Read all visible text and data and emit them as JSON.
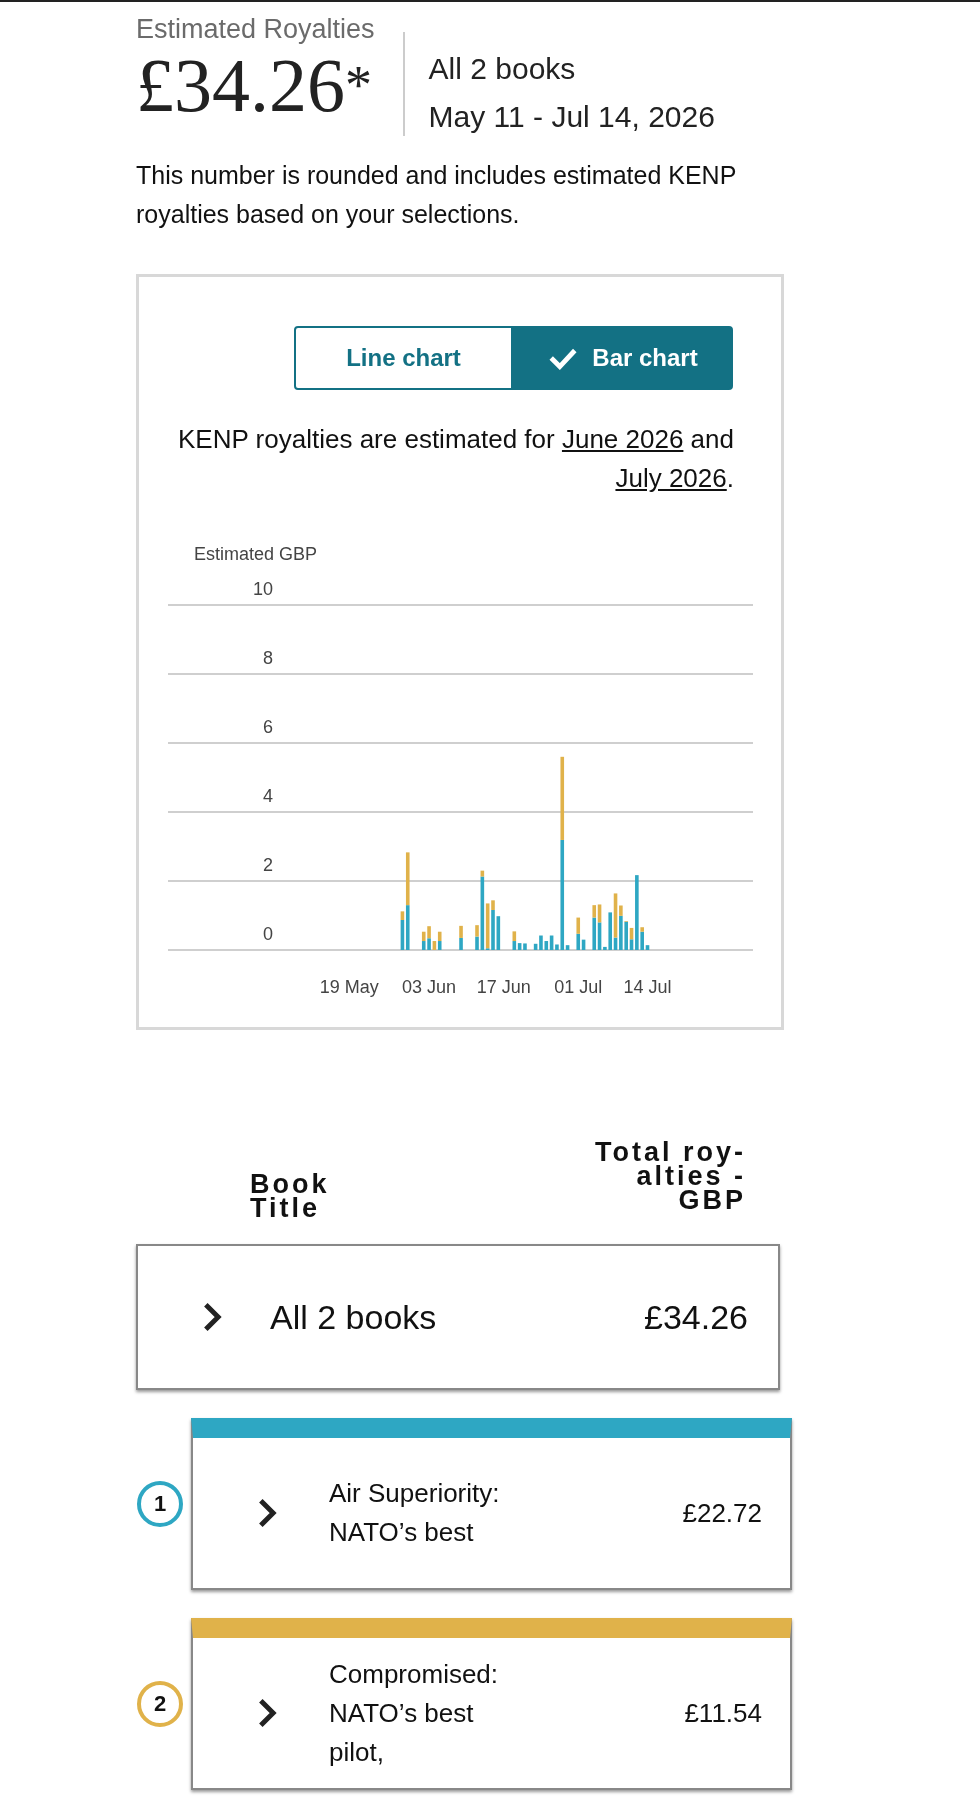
{
  "summary": {
    "label": "Estimated Royalties",
    "amount": "£34.26",
    "footnote_mark": "*",
    "scope": "All 2 books",
    "date_range": "May 11 - Jul 14, 2026",
    "note": "This number is rounded and includes estimated KENP royalties based on your selections."
  },
  "chart_panel": {
    "toggle": [
      {
        "label": "Line chart",
        "selected": false
      },
      {
        "label": "Bar chart",
        "selected": true
      }
    ],
    "estimate_note": {
      "before": "KENP royalties are estimated for ",
      "link_1": "June 2026",
      "middle": " and ",
      "link_2": "July 2026",
      "after": "."
    },
    "chart_data": {
      "type": "bar",
      "stacked": true,
      "ylabel": "Estimated GBP",
      "yticks": [
        0,
        2,
        4,
        6,
        8,
        10
      ],
      "ylim": [
        0,
        10
      ],
      "grid": true,
      "categories": [
        null,
        null,
        null,
        null,
        null,
        null,
        null,
        null,
        "19 May",
        null,
        null,
        null,
        null,
        null,
        null,
        null,
        null,
        null,
        null,
        null,
        null,
        null,
        null,
        "03 Jun",
        null,
        null,
        null,
        null,
        null,
        null,
        null,
        null,
        null,
        null,
        null,
        null,
        null,
        "17 Jun",
        null,
        null,
        null,
        null,
        null,
        null,
        null,
        null,
        null,
        null,
        null,
        null,
        null,
        "01 Jul",
        null,
        null,
        null,
        null,
        null,
        null,
        null,
        null,
        null,
        null,
        null,
        null,
        "14 Jul"
      ],
      "series": [
        {
          "color": "#2ea7c3",
          "values": [
            0,
            0,
            0,
            0,
            0,
            0,
            0,
            0,
            0,
            0,
            0,
            0,
            0,
            0,
            0,
            0,
            0,
            0,
            0.87,
            1.3,
            0,
            0,
            0.26,
            0.34,
            0,
            0.26,
            0,
            0,
            0,
            0.35,
            0,
            0,
            0.39,
            2.13,
            0.05,
            1.16,
            0.98,
            0,
            0,
            0.26,
            0.2,
            0.19,
            0,
            0.18,
            0.42,
            0.26,
            0.42,
            0.16,
            3.19,
            0.14,
            0,
            0.47,
            0.3,
            0,
            0.94,
            0.8,
            0.09,
            1.09,
            0.36,
            0.99,
            0.82,
            0.31,
            2.17,
            0.53,
            0.14
          ]
        },
        {
          "color": "#e0b24a",
          "values": [
            0,
            0,
            0,
            0,
            0,
            0,
            0,
            0,
            0,
            0,
            0,
            0,
            0,
            0,
            0,
            0,
            0,
            0,
            0.25,
            1.53,
            0,
            0,
            0.27,
            0.35,
            0.26,
            0.27,
            0,
            0,
            0,
            0.35,
            0,
            0,
            0.33,
            0.17,
            1.3,
            0.28,
            0,
            0,
            0,
            0.28,
            0,
            0,
            0,
            0,
            0,
            0,
            0,
            0,
            2.41,
            0,
            0,
            0.47,
            0,
            0,
            0.36,
            0.52,
            0,
            0,
            1.28,
            0.3,
            0.02,
            0.33,
            0,
            0.13,
            0
          ]
        }
      ]
    }
  },
  "table": {
    "columns": [
      "Book Title",
      "Total roy-alties - GBP"
    ],
    "total_row": {
      "title": "All 2 books",
      "amount": "£34.26"
    },
    "books": [
      {
        "number": "1",
        "color": "#2ea7c3",
        "title": "Air Superiority: NATO’s best",
        "amount": "£22.72"
      },
      {
        "number": "2",
        "color": "#e0b24a",
        "title": "Compromised: NATO’s best pilot,",
        "amount": "£11.54"
      }
    ]
  }
}
